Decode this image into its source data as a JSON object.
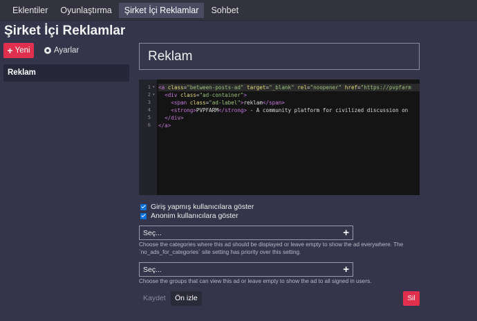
{
  "nav": {
    "tabs": [
      {
        "label": "Eklentiler"
      },
      {
        "label": "Oyunlaştırma"
      },
      {
        "label": "Şirket İçi Reklamlar",
        "active": true
      },
      {
        "label": "Sohbet"
      }
    ]
  },
  "page_title": "Şirket İçi Reklamlar",
  "toolbar": {
    "new_label": "Yeni",
    "settings_label": "Ayarlar"
  },
  "sidebar": {
    "items": [
      {
        "label": "Reklam",
        "selected": true
      }
    ]
  },
  "ad_name": "Reklam",
  "editor": {
    "line_numbers": [
      "1",
      "2",
      "3",
      "4",
      "5",
      "6"
    ],
    "lines": [
      "<a class=\"between-posts-ad\" target=\"_blank\" rel=\"noopener\" href=\"https://pvpfarm",
      "  <div class=\"ad-container\">",
      "    <span class=\"ad-label\">reklam</span>",
      "    <strong>PVPFARM</strong> - A community platform for civilized discussion on",
      "  </div>",
      "</a>"
    ]
  },
  "checkboxes": [
    {
      "label": "Giriş yapmış kullanıcılara göster",
      "checked": true
    },
    {
      "label": "Anonim kullanıcılara göster",
      "checked": true
    }
  ],
  "categories": {
    "placeholder": "Seç...",
    "help": "Choose the categories where this ad should be displayed or leave empty to show the ad everywhere. The `no_ads_for_categories` site setting has priority over this setting."
  },
  "groups": {
    "placeholder": "Seç...",
    "help": "Choose the groups that can view this ad or leave empty to show the ad to all signed in users."
  },
  "actions": {
    "save_label": "Kaydet",
    "preview_label": "Ön izle",
    "delete_label": "Sil"
  },
  "colors": {
    "background": "#34344a",
    "accent": "#e0304e",
    "checkbox": "#0a6fd8",
    "topbar": "#33333f"
  }
}
